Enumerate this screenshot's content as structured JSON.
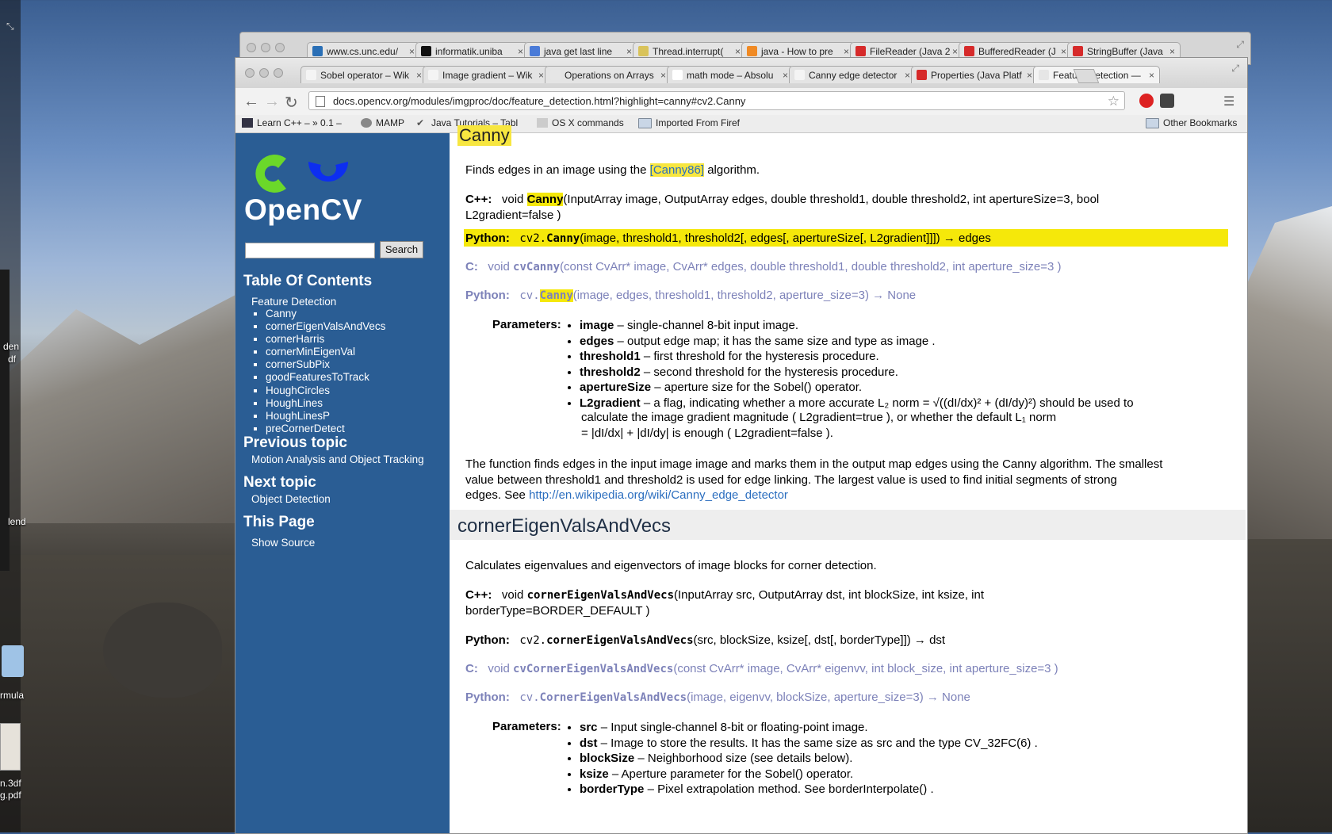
{
  "desktop": {
    "labels": [
      "den",
      "df",
      "lend",
      "rmula",
      "n.3df",
      "g.pdf"
    ]
  },
  "back_window": {
    "tabs": [
      {
        "label": "www.cs.unc.edu/",
        "icon": "gear-favicon"
      },
      {
        "label": "informatik.uniba",
        "icon": "terminal-favicon"
      },
      {
        "label": "java get last line",
        "icon": "google-favicon"
      },
      {
        "label": "Thread.interrupt(",
        "icon": "horseshoe-favicon"
      },
      {
        "label": "java - How to pre",
        "icon": "stack-favicon"
      },
      {
        "label": "FileReader (Java 2",
        "icon": "oracle-favicon"
      },
      {
        "label": "BufferedReader (J",
        "icon": "oracle-favicon"
      },
      {
        "label": "StringBuffer (Java",
        "icon": "oracle-favicon"
      }
    ]
  },
  "browser": {
    "tabs": [
      {
        "label": "Sobel operator – Wik",
        "icon": "wikipedia-favicon"
      },
      {
        "label": "Image gradient – Wik",
        "icon": "wikipedia-favicon"
      },
      {
        "label": "Operations on Arrays",
        "icon": "page-favicon"
      },
      {
        "label": "math mode – Absolu",
        "icon": "braces-favicon"
      },
      {
        "label": "Canny edge detector",
        "icon": "wikipedia-favicon"
      },
      {
        "label": "Properties (Java Platf",
        "icon": "oracle-favicon"
      },
      {
        "label": "Feature Detection —",
        "icon": "page-favicon"
      }
    ],
    "url": "docs.opencv.org/modules/imgproc/doc/feature_detection.html?highlight=canny#cv2.Canny",
    "bookmarks": [
      {
        "label": "Learn C++ – » 0.1 –",
        "icon": "cpp-favicon"
      },
      {
        "label": "MAMP",
        "icon": "mamp-favicon"
      },
      {
        "label": "Java Tutorials – Tabl",
        "icon": "check-favicon"
      },
      {
        "label": "OS X commands",
        "icon": "page-favicon"
      },
      {
        "label": "Imported From Firef",
        "icon": "folder-icon"
      }
    ],
    "other_bookmarks": "Other Bookmarks"
  },
  "sidebar": {
    "logo_text": "OpenCV",
    "search_button": "Search",
    "toc_title": "Table Of Contents",
    "toc_root": "Feature Detection",
    "toc_items": [
      "Canny",
      "cornerEigenValsAndVecs",
      "cornerHarris",
      "cornerMinEigenVal",
      "cornerSubPix",
      "goodFeaturesToTrack",
      "HoughCircles",
      "HoughLines",
      "HoughLinesP",
      "preCornerDetect"
    ],
    "prev_title": "Previous topic",
    "prev_link": "Motion Analysis and Object Tracking",
    "next_title": "Next topic",
    "next_link": "Object Detection",
    "this_page_title": "This Page",
    "show_source": "Show Source"
  },
  "canny": {
    "title": "Canny",
    "desc_pre": "Finds edges in an image using the ",
    "desc_link": "[Canny86]",
    "desc_post": " algorithm.",
    "cpp_label": "C++:",
    "cpp_ret": "void",
    "cpp_name": "Canny",
    "cpp_args_line1": "(InputArray image, OutputArray edges, double threshold1, double threshold2, int apertureSize=3, bool",
    "cpp_args_line2": "L2gradient=false )",
    "py_label": "Python:",
    "py_prefix": "cv2.",
    "py_name": "Canny",
    "py_args": "(image, threshold1, threshold2[, edges[, apertureSize[, L2gradient]]]) → edges",
    "c_label": "C:",
    "c_ret": "void",
    "c_name": "cvCanny",
    "c_args": "(const CvArr* image, CvArr* edges, double threshold1, double threshold2, int aperture_size=3 )",
    "py1_label": "Python:",
    "py1_prefix": "cv.",
    "py1_name": "Canny",
    "py1_args": "(image, edges, threshold1, threshold2, aperture_size=3) → None",
    "params_label": "Parameters:",
    "params": [
      {
        "name": "image",
        "text": " – single-channel 8-bit input image."
      },
      {
        "name": "edges",
        "text": " – output edge map; it has the same size and type as image ."
      },
      {
        "name": "threshold1",
        "text": " – first threshold for the hysteresis procedure."
      },
      {
        "name": "threshold2",
        "text": " – second threshold for the hysteresis procedure."
      },
      {
        "name": "apertureSize",
        "text": " – aperture size for the Sobel() operator."
      },
      {
        "name": "L2gradient",
        "text": " – a flag, indicating whether a more accurate L₂ norm = √((dI/dx)² + (dI/dy)²) should be used to"
      }
    ],
    "l2_cont1": "calculate the image gradient magnitude ( L2gradient=true ), or whether the default L₁ norm",
    "l2_cont2": "= |dI/dx| + |dI/dy| is enough ( L2gradient=false ).",
    "para1": "The function finds edges in the input image image and marks them in the output map edges using the Canny algorithm. The smallest",
    "para2": "value between threshold1 and threshold2 is used for edge linking. The largest value is used to find initial segments of strong",
    "para3_pre": "edges. See ",
    "para3_link": "http://en.wikipedia.org/wiki/Canny_edge_detector"
  },
  "corner": {
    "title": "cornerEigenValsAndVecs",
    "desc": "Calculates eigenvalues and eigenvectors of image blocks for corner detection.",
    "cpp_label": "C++:",
    "cpp_ret": "void",
    "cpp_name": "cornerEigenValsAndVecs",
    "cpp_args_line1": "(InputArray src, OutputArray dst, int blockSize, int ksize, int",
    "cpp_args_line2": "borderType=BORDER_DEFAULT )",
    "py_label": "Python:",
    "py_prefix": "cv2.",
    "py_name": "cornerEigenValsAndVecs",
    "py_args": "(src, blockSize, ksize[, dst[, borderType]]) → dst",
    "c_label": "C:",
    "c_ret": "void",
    "c_name": "cvCornerEigenValsAndVecs",
    "c_args": "(const CvArr* image, CvArr* eigenvv, int block_size, int aperture_size=3 )",
    "py1_label": "Python:",
    "py1_prefix": "cv.",
    "py1_name": "CornerEigenValsAndVecs",
    "py1_args": "(image, eigenvv, blockSize, aperture_size=3) → None",
    "params_label": "Parameters:",
    "params": [
      {
        "name": "src",
        "text": " – Input single-channel 8-bit or floating-point image."
      },
      {
        "name": "dst",
        "text": " – Image to store the results. It has the same size as src and the type CV_32FC(6) ."
      },
      {
        "name": "blockSize",
        "text": " – Neighborhood size (see details below)."
      },
      {
        "name": "ksize",
        "text": " – Aperture parameter for the Sobel() operator."
      },
      {
        "name": "borderType",
        "text": " – Pixel extrapolation method. See borderInterpolate() ."
      }
    ]
  }
}
